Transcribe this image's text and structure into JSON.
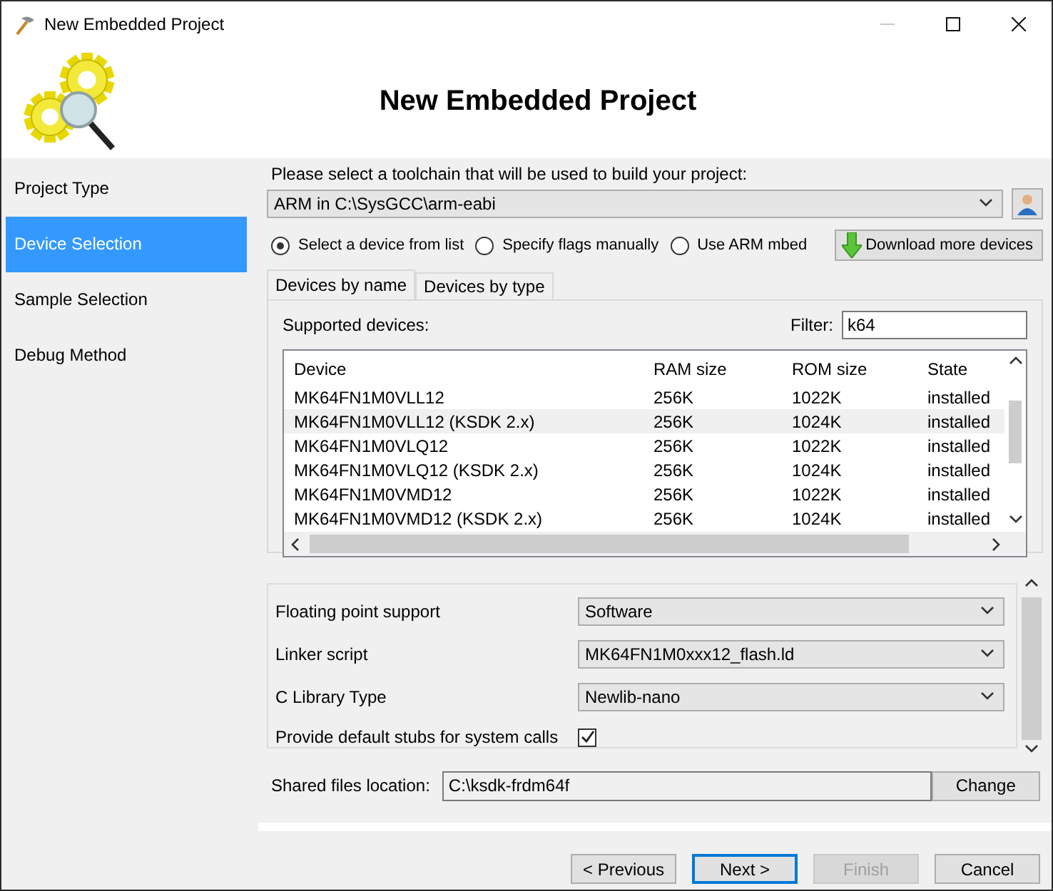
{
  "window": {
    "title": "New Embedded Project",
    "controls": [
      {
        "kind": "minimize",
        "disabled": true
      },
      {
        "kind": "maximize",
        "disabled": false
      },
      {
        "kind": "close",
        "disabled": false
      }
    ]
  },
  "header": {
    "title": "New Embedded Project"
  },
  "sidebar": {
    "items": [
      {
        "label": "Project Type",
        "selected": false
      },
      {
        "label": "Device Selection",
        "selected": true
      },
      {
        "label": "Sample Selection",
        "selected": false
      },
      {
        "label": "Debug Method",
        "selected": false
      }
    ]
  },
  "toolchain": {
    "label": "Please select a toolchain that will be used to build your project:",
    "value": "ARM in C:\\SysGCC\\arm-eabi"
  },
  "modes": [
    {
      "label": "Select a device from list",
      "selected": true
    },
    {
      "label": "Specify flags manually",
      "selected": false
    },
    {
      "label": "Use ARM mbed",
      "selected": false
    }
  ],
  "download_button": "Download more devices",
  "tabs": [
    {
      "label": "Devices by name",
      "selected": true
    },
    {
      "label": "Devices by type",
      "selected": false
    }
  ],
  "devices": {
    "label": "Supported devices:",
    "filter_label": "Filter:",
    "filter_value": "k64",
    "columns": [
      "Device",
      "RAM size",
      "ROM size",
      "State"
    ],
    "rows": [
      {
        "cells": [
          "MK64FN1M0VLL12",
          "256K",
          "1022K",
          "installed"
        ],
        "selected": false
      },
      {
        "cells": [
          "MK64FN1M0VLL12 (KSDK 2.x)",
          "256K",
          "1024K",
          "installed"
        ],
        "selected": true
      },
      {
        "cells": [
          "MK64FN1M0VLQ12",
          "256K",
          "1022K",
          "installed"
        ],
        "selected": false
      },
      {
        "cells": [
          "MK64FN1M0VLQ12 (KSDK 2.x)",
          "256K",
          "1024K",
          "installed"
        ],
        "selected": false
      },
      {
        "cells": [
          "MK64FN1M0VMD12",
          "256K",
          "1022K",
          "installed"
        ],
        "selected": false
      },
      {
        "cells": [
          "MK64FN1M0VMD12 (KSDK 2.x)",
          "256K",
          "1024K",
          "installed"
        ],
        "selected": false
      }
    ]
  },
  "settings": [
    {
      "kind": "dropdown",
      "label": "Floating point support",
      "value": "Software"
    },
    {
      "kind": "dropdown",
      "label": "Linker script",
      "value": "MK64FN1M0xxx12_flash.ld"
    },
    {
      "kind": "dropdown",
      "label": "C Library Type",
      "value": "Newlib-nano"
    },
    {
      "kind": "checkbox",
      "label": "Provide default stubs for system calls",
      "checked": true
    }
  ],
  "shared_files": {
    "label": "Shared files location:",
    "value": "C:\\ksdk-frdm64f",
    "button": "Change"
  },
  "buttons": [
    {
      "label": "< Previous",
      "default": false,
      "disabled": false
    },
    {
      "label": "Next >",
      "default": true,
      "disabled": false
    },
    {
      "label": "Finish",
      "default": false,
      "disabled": true
    },
    {
      "label": "Cancel",
      "default": false,
      "disabled": false
    }
  ]
}
